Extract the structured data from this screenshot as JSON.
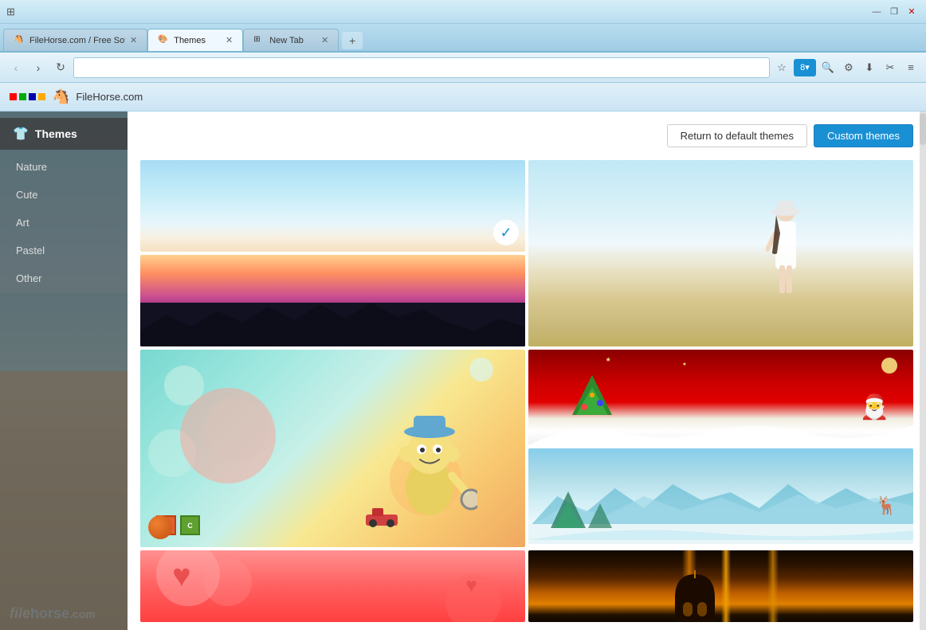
{
  "browser": {
    "titleBar": {
      "controls": [
        "minimize",
        "maximize",
        "close"
      ]
    },
    "tabs": [
      {
        "id": "tab1",
        "label": "FileHorse.com / Free Soft...",
        "favicon": "🐴",
        "active": false
      },
      {
        "id": "tab2",
        "label": "Themes",
        "favicon": "🎨",
        "active": true
      },
      {
        "id": "tab3",
        "label": "New Tab",
        "favicon": "⊞",
        "active": false
      }
    ],
    "addressBar": {
      "url": ""
    },
    "appBar": {
      "logo": "🐴",
      "name": "FileHorse.com"
    }
  },
  "sidebar": {
    "sectionTitle": "Themes",
    "items": [
      {
        "id": "nature",
        "label": "Nature"
      },
      {
        "id": "cute",
        "label": "Cute"
      },
      {
        "id": "art",
        "label": "Art"
      },
      {
        "id": "pastel",
        "label": "Pastel"
      },
      {
        "id": "other",
        "label": "Other"
      }
    ]
  },
  "actionBar": {
    "returnButton": "Return to default themes",
    "customButton": "Custom themes"
  },
  "themes": {
    "items": [
      {
        "id": "sunset",
        "selected": true
      },
      {
        "id": "beach"
      },
      {
        "id": "cartoon"
      },
      {
        "id": "christmas"
      },
      {
        "id": "winter"
      },
      {
        "id": "pink"
      },
      {
        "id": "golden"
      }
    ]
  },
  "icons": {
    "back": "‹",
    "forward": "›",
    "refresh": "↻",
    "star": "☆",
    "search": "🔍",
    "menu": "≡",
    "close": "×",
    "check": "✓",
    "shirt": "👕"
  }
}
